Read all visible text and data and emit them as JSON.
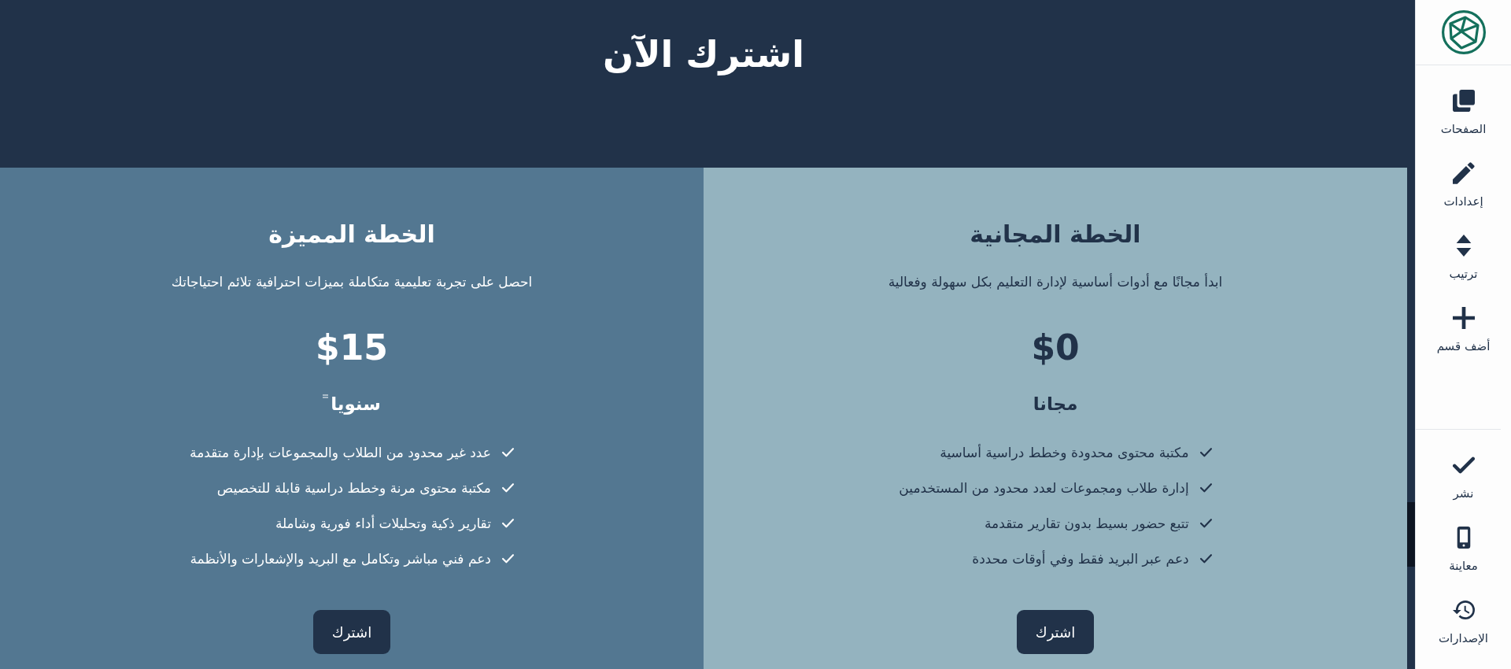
{
  "header": {
    "title": "اشترك الآن"
  },
  "plans": [
    {
      "kind": "free",
      "title": "الخطة المجانية",
      "description": "ابدأ مجانًا مع أدوات أساسية لإدارة التعليم بكل سهولة وفعالية",
      "price": "$0",
      "period": "مجانا",
      "period_mark": false,
      "features": [
        "مكتبة محتوى محدودة وخطط دراسية أساسية",
        "إدارة طلاب ومجموعات لعدد محدود من المستخدمين",
        "تتبع حضور بسيط بدون تقارير متقدمة",
        "دعم عبر البريد فقط وفي أوقات محددة"
      ],
      "button": "اشترك"
    },
    {
      "kind": "premium",
      "title": "الخطة المميزة",
      "description": "احصل على تجربة تعليمية متكاملة بميزات احترافية تلائم احتياجاتك",
      "price": "$15",
      "period": "سنويا",
      "period_mark": true,
      "features": [
        "عدد غير محدود من الطلاب والمجموعات بإدارة متقدمة",
        "مكتبة محتوى مرنة وخطط دراسية قابلة للتخصيص",
        "تقارير ذكية وتحليلات أداء فورية وشاملة",
        "دعم فني مباشر وتكامل مع البريد والإشعارات والأنظمة"
      ],
      "button": "اشترك"
    }
  ],
  "sidebar": {
    "top_items": [
      {
        "kind": "pages",
        "label": "الصفحات"
      },
      {
        "kind": "edit",
        "label": "إعدادات"
      },
      {
        "kind": "order",
        "label": "ترتيب"
      },
      {
        "kind": "add",
        "label": "أضف قسم"
      }
    ],
    "bottom_items": [
      {
        "kind": "publish",
        "label": "نشر"
      },
      {
        "kind": "preview",
        "label": "معاينة"
      },
      {
        "kind": "versions",
        "label": "الإصدارات"
      }
    ]
  }
}
